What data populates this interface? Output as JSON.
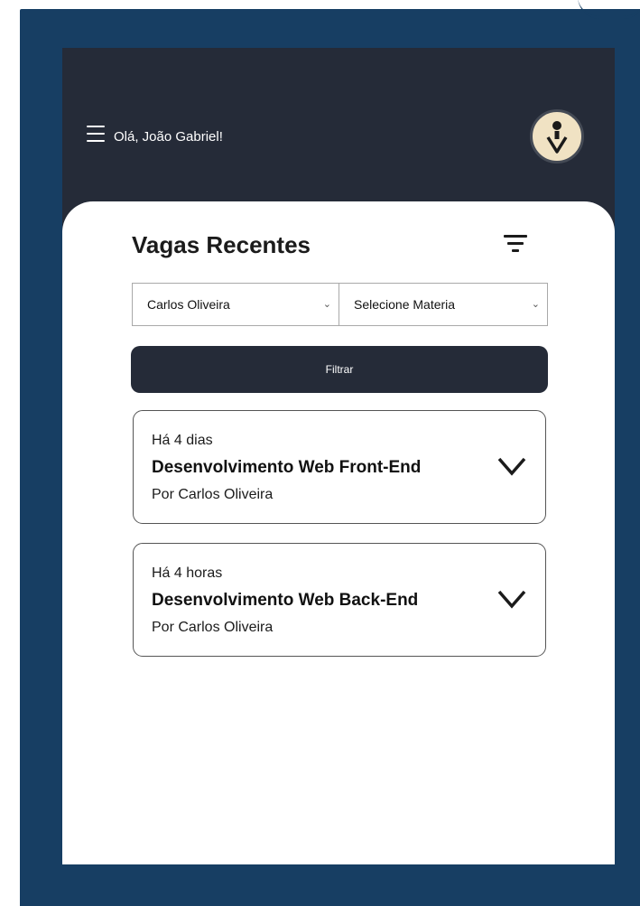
{
  "header": {
    "greeting": "Olá, João Gabriel!",
    "menu_icon": "hamburger-menu-icon",
    "avatar_icon": "person-logo-icon"
  },
  "main": {
    "title": "Vagas Recentes",
    "filter_icon": "filter-lines-icon",
    "selects": {
      "professor": {
        "selected": "Carlos Oliveira"
      },
      "materia": {
        "selected": "Selecione Materia"
      }
    },
    "filter_button_label": "Filtrar",
    "jobs": [
      {
        "when": "Há 4 dias",
        "course": "Desenvolvimento Web Front-End",
        "author": "Por Carlos Oliveira"
      },
      {
        "when": "Há 4 horas",
        "course": "Desenvolvimento Web Back-End",
        "author": "Por Carlos Oliveira"
      }
    ]
  },
  "colors": {
    "background_frame": "#173e63",
    "header_dark": "#252b38",
    "avatar_bg": "#f0e2c3",
    "text_dark": "#1b1b1b"
  }
}
